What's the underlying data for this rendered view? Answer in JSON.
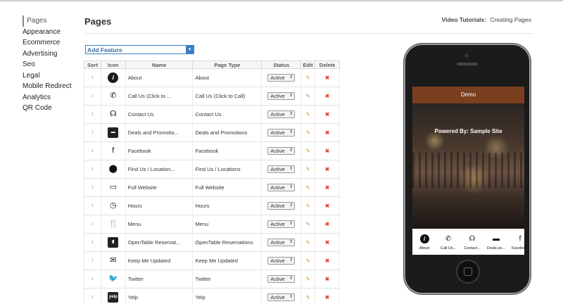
{
  "sidebar": {
    "items": [
      {
        "label": "Pages",
        "active": true
      },
      {
        "label": "Appearance"
      },
      {
        "label": "Ecommerce"
      },
      {
        "label": "Advertising"
      },
      {
        "label": "Seo"
      },
      {
        "label": "Legal"
      },
      {
        "label": "Mobile Redirect"
      },
      {
        "label": "Analytics"
      },
      {
        "label": "QR Code"
      }
    ]
  },
  "header": {
    "title": "Pages",
    "tutorials_label": "Video Tutorials:",
    "tutorials_link": "Creating Pages"
  },
  "add_feature": {
    "label": "Add Feature",
    "arrow": "▾"
  },
  "table": {
    "headers": [
      "Sort",
      "Icon",
      "Name",
      "Page Type",
      "Status",
      "Edit",
      "Delete"
    ],
    "sort_glyph": "↕",
    "edit_glyph": "✎",
    "delete_glyph": "✖",
    "status_arrow": "⇕",
    "rows": [
      {
        "icon": "info-icon",
        "glyph": "i",
        "name": "About",
        "type": "About",
        "status": "Active"
      },
      {
        "icon": "phone-icon",
        "glyph": "✆",
        "name": "Call Us (Click to ...",
        "type": "Call Us (Click to Call)",
        "status": "Active"
      },
      {
        "icon": "headset-icon",
        "glyph": "☊",
        "name": "Contact Us",
        "type": "Contact Us",
        "status": "Active"
      },
      {
        "icon": "ticket-icon",
        "glyph": "▬",
        "name": "Deals and Promotio...",
        "type": "Deals and Promotions",
        "status": "Active"
      },
      {
        "icon": "facebook-icon",
        "glyph": "f",
        "name": "Facebook",
        "type": "Facebook",
        "status": "Active"
      },
      {
        "icon": "location-icon",
        "glyph": "⬤",
        "name": "Find Us / Location...",
        "type": "Find Us / Locations",
        "status": "Active"
      },
      {
        "icon": "laptop-icon",
        "glyph": "▭",
        "name": "Full Website",
        "type": "Full Website",
        "status": "Active"
      },
      {
        "icon": "clock-icon",
        "glyph": "◷",
        "name": "Hours",
        "type": "Hours",
        "status": "Active"
      },
      {
        "icon": "utensils-icon",
        "glyph": "🍴",
        "name": "Menu",
        "type": "Menu",
        "status": "Active"
      },
      {
        "icon": "reservation-icon",
        "glyph": "▮",
        "name": "OpenTable Reservat...",
        "type": "OpenTable Reservations",
        "status": "Active"
      },
      {
        "icon": "newsletter-icon",
        "glyph": "✉",
        "name": "Keep Me Updated",
        "type": "Keep Me Updated",
        "status": "Active"
      },
      {
        "icon": "twitter-icon",
        "glyph": "🐦",
        "name": "Twitter",
        "type": "Twitter",
        "status": "Active"
      },
      {
        "icon": "yelp-icon",
        "glyph": "yelp",
        "name": "Yelp",
        "type": "Yelp",
        "status": "Active"
      }
    ]
  },
  "phone": {
    "header_title": "Demo",
    "powered_by": "Powered By: Sample Site",
    "nav": [
      {
        "icon": "info-icon",
        "glyph": "i",
        "label": "About"
      },
      {
        "icon": "phone-icon",
        "glyph": "✆",
        "label": "Call Us..."
      },
      {
        "icon": "headset-icon",
        "glyph": "☊",
        "label": "Contact..."
      },
      {
        "icon": "ticket-icon",
        "glyph": "▬",
        "label": "Deals an..."
      },
      {
        "icon": "facebook-icon",
        "glyph": "f",
        "label": "Facebook"
      }
    ]
  }
}
